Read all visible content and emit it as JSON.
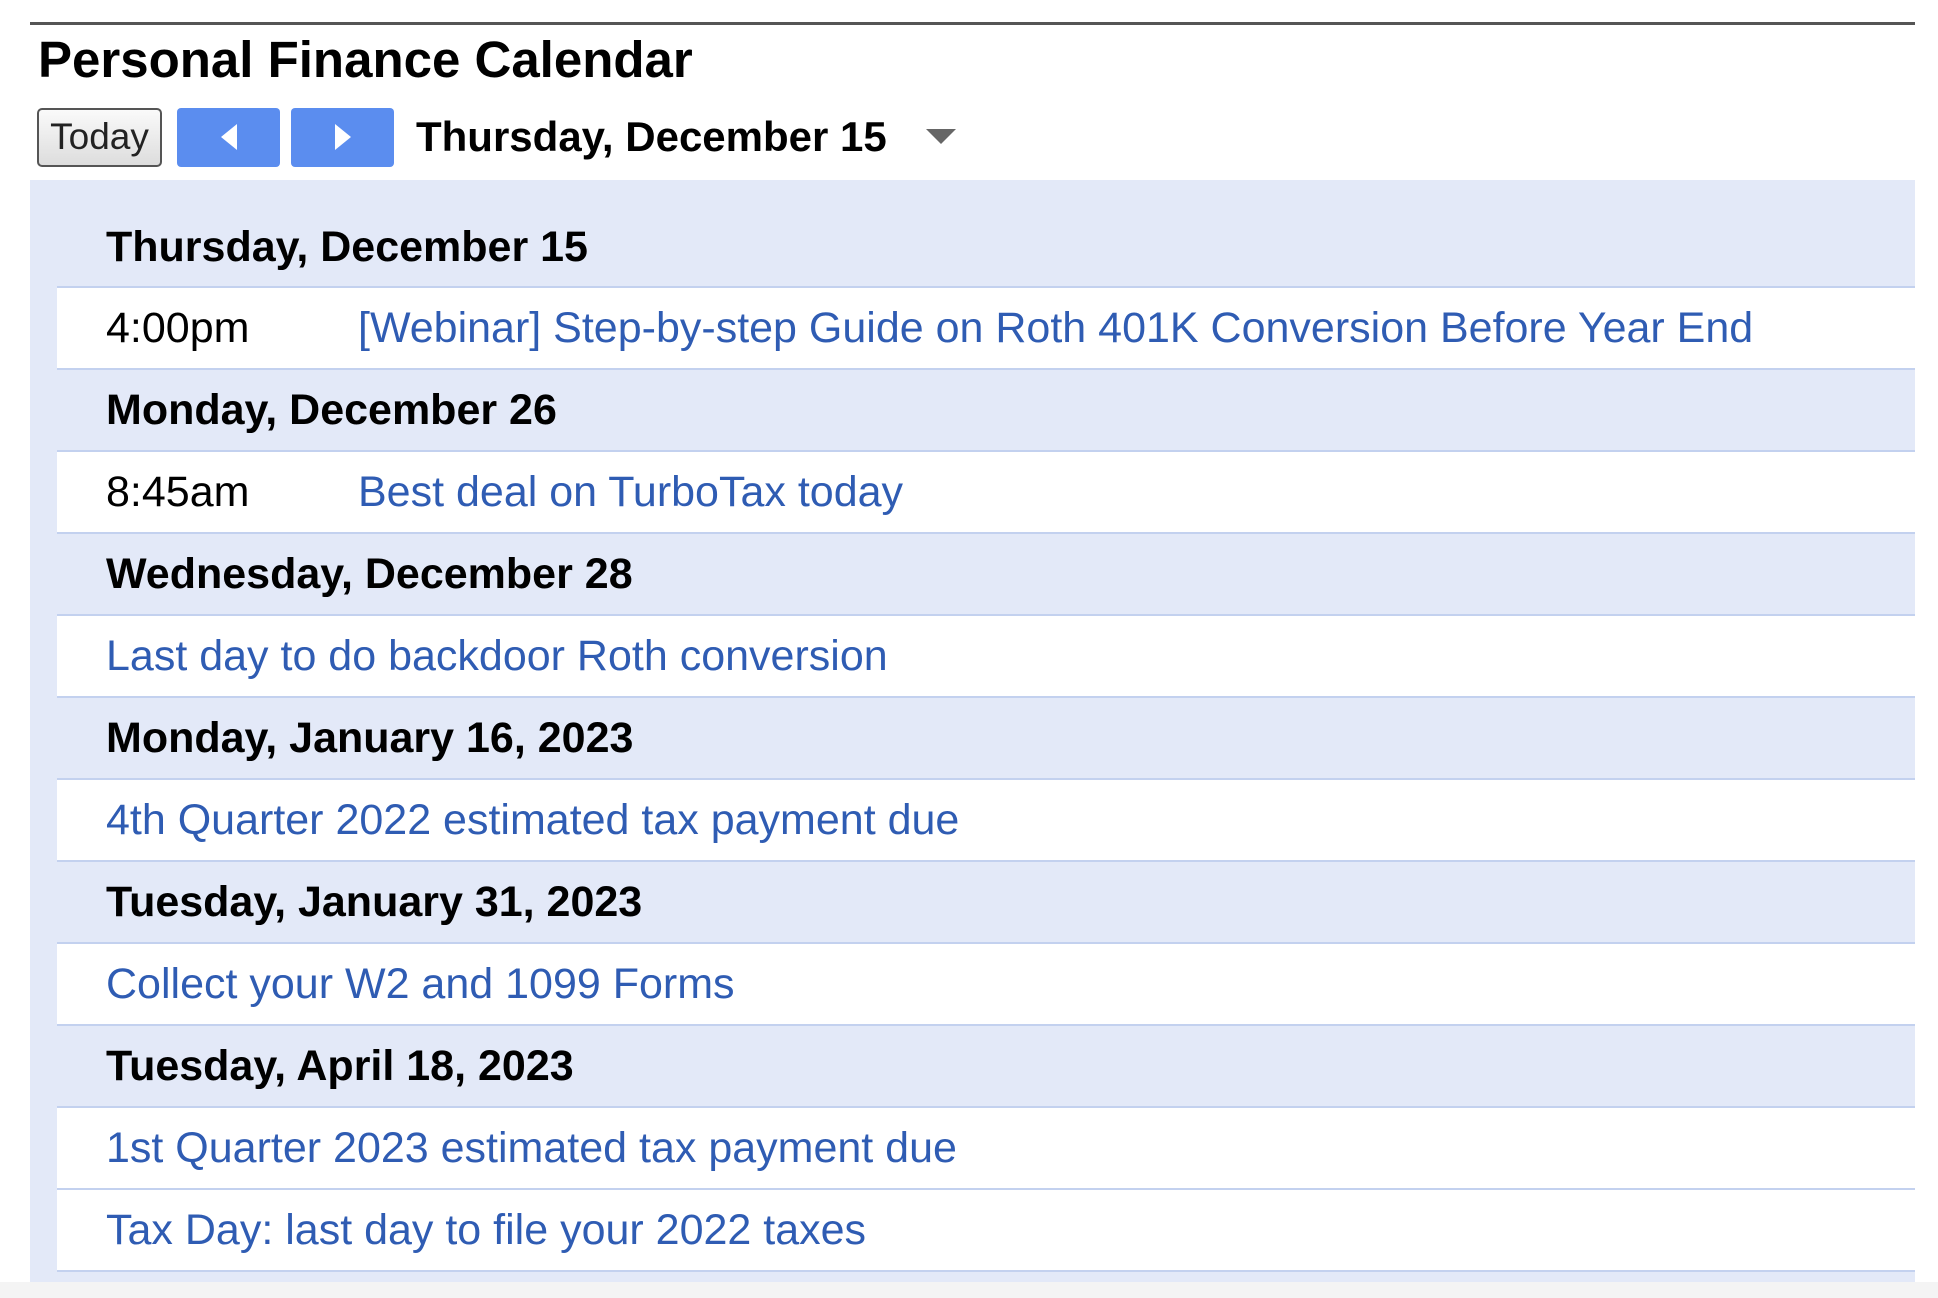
{
  "page": {
    "title": "Personal Finance Calendar"
  },
  "toolbar": {
    "today_label": "Today",
    "prev_icon": "chevron-left-icon",
    "next_icon": "chevron-right-icon",
    "current_date": "Thursday, December 15",
    "dropdown_icon": "caret-down-icon"
  },
  "colors": {
    "nav_button": "#5b8def",
    "agenda_background": "#e3e9f8",
    "event_link": "#2f5cb3",
    "row_divider": "#c3d1ef"
  },
  "agenda": {
    "days": [
      {
        "date": "Thursday, December 15",
        "events": [
          {
            "time": "4:00pm",
            "title": "[Webinar] Step-by-step Guide on Roth 401K Conversion Before Year End"
          }
        ]
      },
      {
        "date": "Monday, December 26",
        "events": [
          {
            "time": "8:45am",
            "title": "Best deal on TurboTax today"
          }
        ]
      },
      {
        "date": "Wednesday, December 28",
        "events": [
          {
            "time": "",
            "title": "Last day to do backdoor Roth conversion"
          }
        ]
      },
      {
        "date": "Monday, January 16, 2023",
        "events": [
          {
            "time": "",
            "title": "4th Quarter 2022 estimated tax payment due"
          }
        ]
      },
      {
        "date": "Tuesday, January 31, 2023",
        "events": [
          {
            "time": "",
            "title": "Collect your W2 and 1099 Forms"
          }
        ]
      },
      {
        "date": "Tuesday, April 18, 2023",
        "events": [
          {
            "time": "",
            "title": "1st Quarter 2023 estimated tax payment due"
          },
          {
            "time": "",
            "title": "Tax Day: last day to file your 2022 taxes"
          }
        ]
      }
    ]
  }
}
